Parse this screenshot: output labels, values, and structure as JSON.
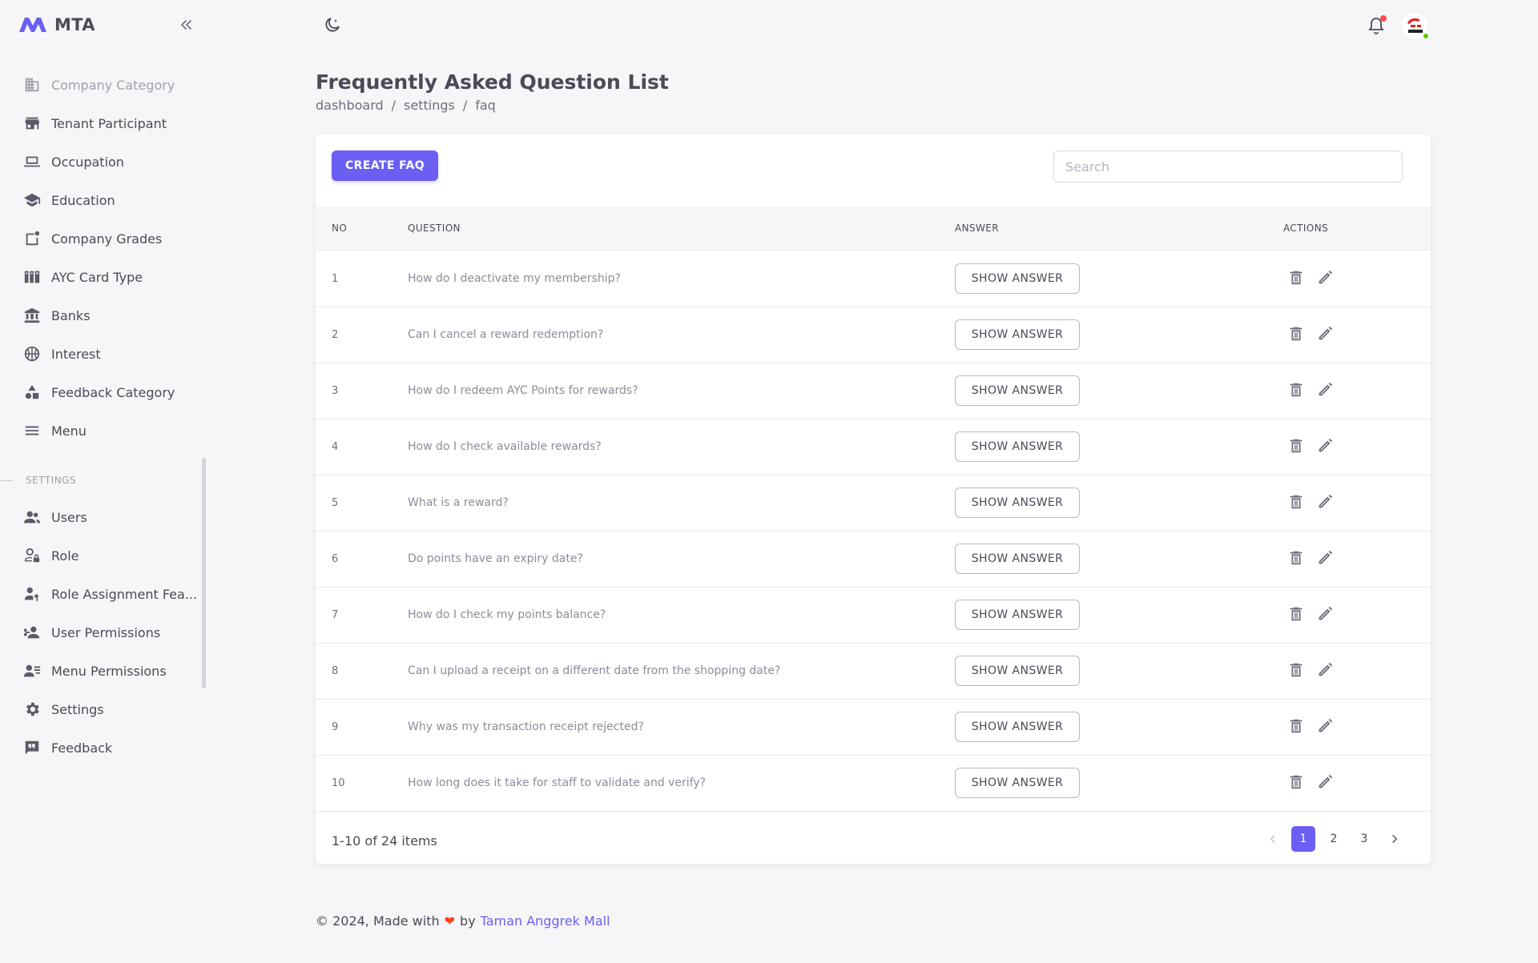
{
  "app": {
    "name": "MTA"
  },
  "sidebar": {
    "items": [
      {
        "label": "Company Category",
        "icon": "building-icon"
      },
      {
        "label": "Tenant Participant",
        "icon": "store-icon"
      },
      {
        "label": "Occupation",
        "icon": "laptop-icon"
      },
      {
        "label": "Education",
        "icon": "school-icon"
      },
      {
        "label": "Company Grades",
        "icon": "note-badge-icon"
      },
      {
        "label": "AYC Card Type",
        "icon": "cards-icon"
      },
      {
        "label": "Banks",
        "icon": "bank-icon"
      },
      {
        "label": "Interest",
        "icon": "basketball-icon"
      },
      {
        "label": "Feedback Category",
        "icon": "shapes-icon"
      },
      {
        "label": "Menu",
        "icon": "menu-icon"
      }
    ],
    "section_label": "SETTINGS",
    "settings_items": [
      {
        "label": "Users",
        "icon": "users-icon"
      },
      {
        "label": "Role",
        "icon": "user-lock-icon"
      },
      {
        "label": "Role Assignment Fea...",
        "icon": "user-key-icon"
      },
      {
        "label": "User Permissions",
        "icon": "user-network-icon"
      },
      {
        "label": "Menu Permissions",
        "icon": "user-list-icon"
      },
      {
        "label": "Settings",
        "icon": "gear-icon"
      },
      {
        "label": "Feedback",
        "icon": "quote-message-icon"
      }
    ]
  },
  "header": {
    "title": "Frequently Asked Question List",
    "breadcrumb": [
      "dashboard",
      "/",
      "settings",
      "/",
      "faq"
    ]
  },
  "toolbar": {
    "create_label": "CREATE FAQ",
    "search_placeholder": "Search"
  },
  "table": {
    "columns": [
      "NO",
      "QUESTION",
      "ANSWER",
      "ACTIONS"
    ],
    "show_answer_label": "SHOW ANSWER",
    "rows": [
      {
        "no": "1",
        "question": "How do I deactivate my membership?"
      },
      {
        "no": "2",
        "question": "Can I cancel a reward redemption?"
      },
      {
        "no": "3",
        "question": "How do I redeem AYC Points for rewards?"
      },
      {
        "no": "4",
        "question": "How do I check available rewards?"
      },
      {
        "no": "5",
        "question": "What is a reward?"
      },
      {
        "no": "6",
        "question": "Do points have an expiry date?"
      },
      {
        "no": "7",
        "question": "How do I check my points balance?"
      },
      {
        "no": "8",
        "question": "Can I upload a receipt on a different date from the shopping date?"
      },
      {
        "no": "9",
        "question": "Why was my transaction receipt rejected?"
      },
      {
        "no": "10",
        "question": "How long does it take for staff to validate and verify?"
      }
    ]
  },
  "pagination": {
    "info": "1-10 of 24 items",
    "pages": [
      "1",
      "2",
      "3"
    ],
    "current": "1"
  },
  "footer": {
    "prefix": "© 2024, Made with",
    "by": "by",
    "link": "Taman Anggrek Mall"
  },
  "colors": {
    "accent": "#6a5ff2",
    "notification": "#ff4c51",
    "online": "#56ca00",
    "heart": "#ff3e1d"
  }
}
